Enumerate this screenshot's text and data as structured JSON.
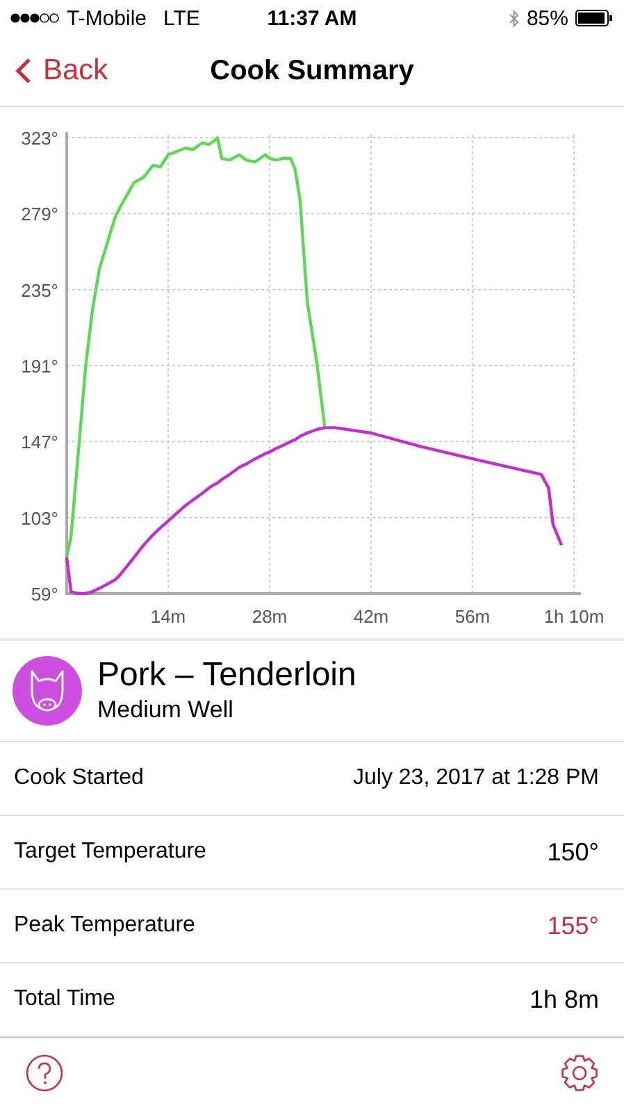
{
  "status_bar": {
    "carrier": "T-Mobile",
    "network": "LTE",
    "time": "11:37 AM",
    "battery": "85%"
  },
  "nav": {
    "back": "Back",
    "title": "Cook Summary"
  },
  "chart": {
    "chart_data": {
      "type": "line",
      "xlim": [
        0,
        70
      ],
      "ylim": [
        59,
        323
      ],
      "grid": true,
      "xticks": [
        {
          "value": 14,
          "label": "14m"
        },
        {
          "value": 28,
          "label": "28m"
        },
        {
          "value": 42,
          "label": "42m"
        },
        {
          "value": 56,
          "label": "56m"
        },
        {
          "value": 70,
          "label": "1h 10m"
        }
      ],
      "yticks": [
        {
          "value": 59,
          "label": "59°"
        },
        {
          "value": 103,
          "label": "103°"
        },
        {
          "value": 147,
          "label": "147°"
        },
        {
          "value": 191,
          "label": "191°"
        },
        {
          "value": 235,
          "label": "235°"
        },
        {
          "value": 279,
          "label": "279°"
        },
        {
          "value": 323,
          "label": "323°"
        }
      ],
      "x": [
        0,
        0.6,
        1.6,
        2.6,
        3.5,
        4.5,
        6.7,
        7.4,
        9.3,
        10.6,
        11.9,
        12.9,
        14,
        16.4,
        17.4,
        18.7,
        19.6,
        20.3,
        20.8,
        21.4,
        22.5,
        23.8,
        24.8,
        26,
        27.4,
        28,
        28.9,
        29.9,
        30.9,
        31.5,
        32.2,
        33.2,
        34.5,
        35.6,
        37,
        42,
        49,
        56,
        65.5,
        66.5,
        67.1,
        68.3
      ],
      "series": [
        {
          "color": "#5dd855",
          "values": [
            80,
            92,
            140,
            190,
            222,
            247,
            277,
            283,
            297,
            300,
            307,
            306,
            313,
            317,
            316,
            320,
            319,
            321,
            323,
            311,
            310,
            313,
            310,
            309,
            313,
            311,
            310,
            311,
            311,
            305,
            287,
            228,
            193,
            156,
            null,
            null,
            null,
            null,
            null,
            null,
            null,
            null
          ]
        },
        {
          "color": "#c22fd0",
          "values": [
            80,
            60,
            59,
            59,
            60,
            62,
            67,
            70,
            80,
            87,
            93,
            97,
            101,
            110,
            113,
            117,
            120,
            122,
            123,
            125,
            128,
            132,
            134,
            137,
            140,
            141,
            143,
            145,
            147,
            148,
            150,
            152,
            154,
            155,
            155,
            152,
            144,
            137,
            128,
            120,
            99,
            87
          ]
        }
      ]
    }
  },
  "food": {
    "name": "Pork – Tenderloin",
    "doneness": "Medium Well"
  },
  "details": [
    {
      "kind": "date",
      "label": "Cook Started",
      "value": "July 23, 2017 at 1:28 PM",
      "alert": false
    },
    {
      "kind": "temperature",
      "label": "Target Temperature",
      "value": "150°",
      "alert": false
    },
    {
      "kind": "temperature",
      "label": "Peak Temperature",
      "value": "155°",
      "alert": true
    },
    {
      "kind": "time",
      "label": "Total Time",
      "value": "1h 8m",
      "alert": false
    }
  ]
}
